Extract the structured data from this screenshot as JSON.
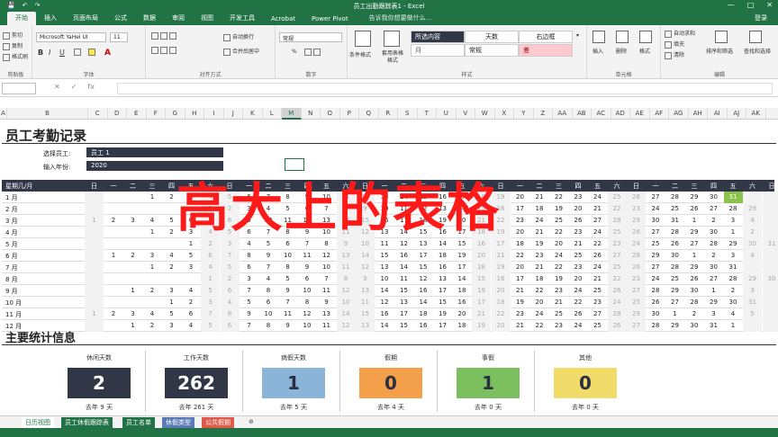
{
  "window": {
    "title": "员工出勤跟踪表1 - Excel",
    "controls": [
      "—",
      "□",
      "✕"
    ],
    "quick_access": [
      "💾",
      "↶",
      "↷"
    ]
  },
  "menu": {
    "tabs": [
      "开始",
      "插入",
      "页面布局",
      "公式",
      "数据",
      "审阅",
      "视图",
      "开发工具",
      "Acrobat",
      "Power Pivot"
    ],
    "active": "开始",
    "tell_me": "告诉我你想要做什么...",
    "login": "登录"
  },
  "ribbon": {
    "clipboard": {
      "label": "剪贴板",
      "cut": "剪切",
      "copy": "复制",
      "painter": "格式刷"
    },
    "font": {
      "label": "字体",
      "name": "Microsoft YaHei UI",
      "size": "11",
      "bold": "B",
      "italic": "I",
      "underline": "U"
    },
    "align": {
      "label": "对齐方式",
      "wrap": "自动换行",
      "merge": "合并后居中"
    },
    "number": {
      "label": "数字",
      "format": "常规",
      "pct": "%"
    },
    "styles": {
      "label": "样式",
      "cond": "条件格式",
      "table": "套用表格格式",
      "cells": [
        "所选内容",
        "天数",
        "右边框",
        "月",
        "常规",
        "差"
      ]
    },
    "cellsgrp": {
      "label": "单元格",
      "insert": "插入",
      "delete": "删除",
      "format": "格式"
    },
    "editing": {
      "label": "编辑",
      "autosum": "自动求和",
      "fill": "填充",
      "clear": "清除",
      "sort": "排序和筛选",
      "find": "查找和选择"
    }
  },
  "formula_bar": {
    "fx": "fx"
  },
  "columns": [
    "A",
    "B",
    "C",
    "D",
    "E",
    "F",
    "G",
    "H",
    "I",
    "J",
    "K",
    "L",
    "M",
    "N",
    "O",
    "P",
    "Q",
    "R",
    "S",
    "T",
    "U",
    "V",
    "W",
    "X",
    "Y",
    "Z",
    "AA",
    "AB",
    "AC",
    "AD",
    "AE",
    "AF",
    "AG",
    "AH",
    "AI",
    "AJ",
    "AK"
  ],
  "selected_column": "M",
  "sheet": {
    "title": "员工考勤记录",
    "select_label": "选择员工:",
    "select_value": "员工 1",
    "year_label": "输入年份:",
    "year_value": "2020"
  },
  "calendar": {
    "header_label": "星期几/月",
    "weekdays": [
      "日",
      "一",
      "二",
      "三",
      "四",
      "五",
      "六",
      "日",
      "一",
      "二",
      "三",
      "四",
      "五",
      "六",
      "日",
      "一",
      "二",
      "三",
      "四",
      "五",
      "六",
      "日",
      "一",
      "二",
      "三",
      "四",
      "五",
      "六",
      "日",
      "一",
      "二",
      "三",
      "四",
      "五",
      "六",
      "日",
      "一"
    ],
    "months": [
      {
        "label": "1 月",
        "days": [
          "",
          "",
          "",
          "1",
          "2",
          "3",
          "4",
          "5",
          "6",
          "7",
          "8",
          "9",
          "10",
          "11",
          "12",
          "13",
          "14",
          "15",
          "16",
          "17",
          "18",
          "19",
          "20",
          "21",
          "22",
          "23",
          "24",
          "25",
          "26",
          "27",
          "28",
          "29",
          "30",
          "31",
          "",
          ""
        ]
      },
      {
        "label": "2 月",
        "days": [
          "",
          "",
          "",
          "",
          "",
          "",
          "1",
          "2",
          "3",
          "4",
          "5",
          "6",
          "7",
          "8",
          "9",
          "10",
          "11",
          "12",
          "13",
          "14",
          "15",
          "16",
          "17",
          "18",
          "19",
          "20",
          "21",
          "22",
          "23",
          "24",
          "25",
          "26",
          "27",
          "28",
          "29",
          "",
          ""
        ]
      },
      {
        "label": "3 月",
        "days": [
          "1",
          "2",
          "3",
          "4",
          "5",
          "6",
          "7",
          "8",
          "9",
          "10",
          "11",
          "12",
          "13",
          "14",
          "15",
          "16",
          "17",
          "18",
          "19",
          "20",
          "21",
          "22",
          "23",
          "24",
          "25",
          "26",
          "27",
          "28",
          "29",
          "30",
          "31",
          "1",
          "2",
          "3",
          "4",
          "",
          ""
        ]
      },
      {
        "label": "4 月",
        "days": [
          "",
          "",
          "",
          "1",
          "2",
          "3",
          "4",
          "5",
          "6",
          "7",
          "8",
          "9",
          "10",
          "11",
          "12",
          "13",
          "14",
          "15",
          "16",
          "17",
          "18",
          "19",
          "20",
          "21",
          "22",
          "23",
          "24",
          "25",
          "26",
          "27",
          "28",
          "29",
          "30",
          "1",
          "2",
          "",
          ""
        ]
      },
      {
        "label": "5 月",
        "days": [
          "",
          "",
          "",
          "",
          "",
          "1",
          "2",
          "3",
          "4",
          "5",
          "6",
          "7",
          "8",
          "9",
          "10",
          "11",
          "12",
          "13",
          "14",
          "15",
          "16",
          "17",
          "18",
          "19",
          "20",
          "21",
          "22",
          "23",
          "24",
          "25",
          "26",
          "27",
          "28",
          "29",
          "30",
          "31",
          ""
        ]
      },
      {
        "label": "6 月",
        "days": [
          "",
          "1",
          "2",
          "3",
          "4",
          "5",
          "6",
          "7",
          "8",
          "9",
          "10",
          "11",
          "12",
          "13",
          "14",
          "15",
          "16",
          "17",
          "18",
          "19",
          "20",
          "21",
          "22",
          "23",
          "24",
          "25",
          "26",
          "27",
          "28",
          "29",
          "30",
          "1",
          "2",
          "3",
          "4",
          "",
          ""
        ]
      },
      {
        "label": "7 月",
        "days": [
          "",
          "",
          "",
          "1",
          "2",
          "3",
          "4",
          "5",
          "6",
          "7",
          "8",
          "9",
          "10",
          "11",
          "12",
          "13",
          "14",
          "15",
          "16",
          "17",
          "18",
          "19",
          "20",
          "21",
          "22",
          "23",
          "24",
          "25",
          "26",
          "27",
          "28",
          "29",
          "30",
          "31",
          "",
          "",
          ""
        ]
      },
      {
        "label": "8 月",
        "days": [
          "",
          "",
          "",
          "",
          "",
          "",
          "1",
          "2",
          "3",
          "4",
          "5",
          "6",
          "7",
          "8",
          "9",
          "10",
          "11",
          "12",
          "13",
          "14",
          "15",
          "16",
          "17",
          "18",
          "19",
          "20",
          "21",
          "22",
          "23",
          "24",
          "25",
          "26",
          "27",
          "28",
          "29",
          "30",
          "31"
        ]
      },
      {
        "label": "9 月",
        "days": [
          "",
          "",
          "1",
          "2",
          "3",
          "4",
          "5",
          "6",
          "7",
          "8",
          "9",
          "10",
          "11",
          "12",
          "13",
          "14",
          "15",
          "16",
          "17",
          "18",
          "19",
          "20",
          "21",
          "22",
          "23",
          "24",
          "25",
          "26",
          "27",
          "28",
          "29",
          "30",
          "1",
          "2",
          "3",
          "",
          ""
        ]
      },
      {
        "label": "10 月",
        "days": [
          "",
          "",
          "",
          "",
          "1",
          "2",
          "3",
          "4",
          "5",
          "6",
          "7",
          "8",
          "9",
          "10",
          "11",
          "12",
          "13",
          "14",
          "15",
          "16",
          "17",
          "18",
          "19",
          "20",
          "21",
          "22",
          "23",
          "24",
          "25",
          "26",
          "27",
          "28",
          "29",
          "30",
          "31",
          "",
          ""
        ]
      },
      {
        "label": "11 月",
        "days": [
          "1",
          "2",
          "3",
          "4",
          "5",
          "6",
          "7",
          "8",
          "9",
          "10",
          "11",
          "12",
          "13",
          "14",
          "15",
          "16",
          "17",
          "18",
          "19",
          "20",
          "21",
          "22",
          "23",
          "24",
          "25",
          "26",
          "27",
          "28",
          "29",
          "30",
          "1",
          "2",
          "3",
          "4",
          "5",
          "",
          ""
        ]
      },
      {
        "label": "12 月",
        "days": [
          "",
          "",
          "1",
          "2",
          "3",
          "4",
          "5",
          "6",
          "7",
          "8",
          "9",
          "10",
          "11",
          "12",
          "13",
          "14",
          "15",
          "16",
          "17",
          "18",
          "19",
          "20",
          "21",
          "22",
          "23",
          "24",
          "25",
          "26",
          "27",
          "28",
          "29",
          "30",
          "31",
          "1",
          "",
          "",
          ""
        ]
      }
    ]
  },
  "overlay_text": "高大上的表格",
  "stats": {
    "title": "主要统计信息",
    "items": [
      {
        "label": "休闲天数",
        "value": "2",
        "sub": "去年 9 天",
        "color": "#323748",
        "text": "#ffffff"
      },
      {
        "label": "工作天数",
        "value": "262",
        "sub": "去年 261 天",
        "color": "#323748",
        "text": "#ffffff"
      },
      {
        "label": "病假天数",
        "value": "1",
        "sub": "去年 5 天",
        "color": "#8ab4d8",
        "text": "#2b2f40"
      },
      {
        "label": "假期",
        "value": "0",
        "sub": "去年 4 天",
        "color": "#f4a04a",
        "text": "#2b2f40"
      },
      {
        "label": "事假",
        "value": "1",
        "sub": "去年 0 天",
        "color": "#7bbf5e",
        "text": "#2b2f40"
      },
      {
        "label": "其他",
        "value": "0",
        "sub": "去年 0 天",
        "color": "#f1dc6a",
        "text": "#2b2f40"
      }
    ]
  },
  "sheet_tabs": [
    {
      "label": "日历视图",
      "color": "#ffffff",
      "text": "#217346"
    },
    {
      "label": "员工休假跟踪表",
      "color": "#217346",
      "text": "#ffffff"
    },
    {
      "label": "员工名单",
      "color": "#217346",
      "text": "#ffffff"
    },
    {
      "label": "休假类型",
      "color": "#5b7bb5",
      "text": "#ffffff"
    },
    {
      "label": "公共假期",
      "color": "#e05a4a",
      "text": "#ffffff"
    }
  ],
  "add_sheet": "⊕"
}
